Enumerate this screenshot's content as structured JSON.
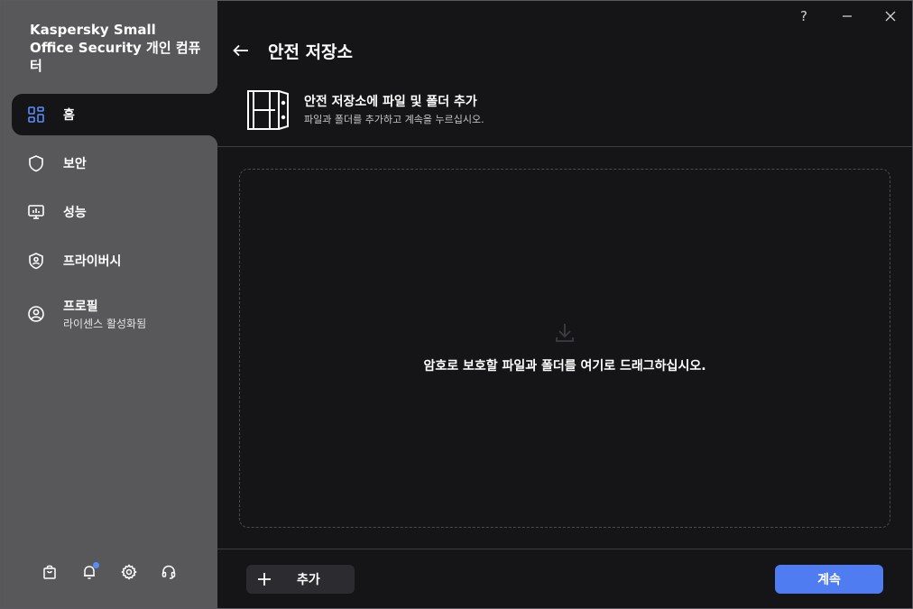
{
  "app": {
    "title": "Kaspersky Small Office Security 개인 컴퓨터"
  },
  "window_controls": {
    "help": "?",
    "minimize": "—",
    "close": "✕"
  },
  "sidebar": {
    "items": [
      {
        "label": "홈",
        "icon": "home-grid-icon",
        "active": true
      },
      {
        "label": "보안",
        "icon": "shield-icon"
      },
      {
        "label": "성능",
        "icon": "monitor-performance-icon"
      },
      {
        "label": "프라이버시",
        "icon": "privacy-shield-icon"
      },
      {
        "label": "프로필",
        "sub": "라이센스 활성화됨",
        "icon": "profile-icon"
      }
    ],
    "footer_icons": [
      "store-bag-icon",
      "notification-bell-icon",
      "settings-gear-icon",
      "support-headset-icon"
    ],
    "notification_dot_color": "#5b8dfa"
  },
  "page": {
    "title": "안전 저장소",
    "header_title": "안전 저장소에 파일 및 폴더 추가",
    "header_subtitle": "파일과 폴더를 추가하고 계속을 누르십시오."
  },
  "dropzone": {
    "text": "암호로 보호할 파일과 폴더를 여기로 드래그하십시오."
  },
  "buttons": {
    "add": "추가",
    "continue": "계속"
  },
  "colors": {
    "sidebar_bg": "#58585a",
    "main_bg": "#151518",
    "accent": "#4f7cf0",
    "active_icon": "#5b8dfa"
  }
}
